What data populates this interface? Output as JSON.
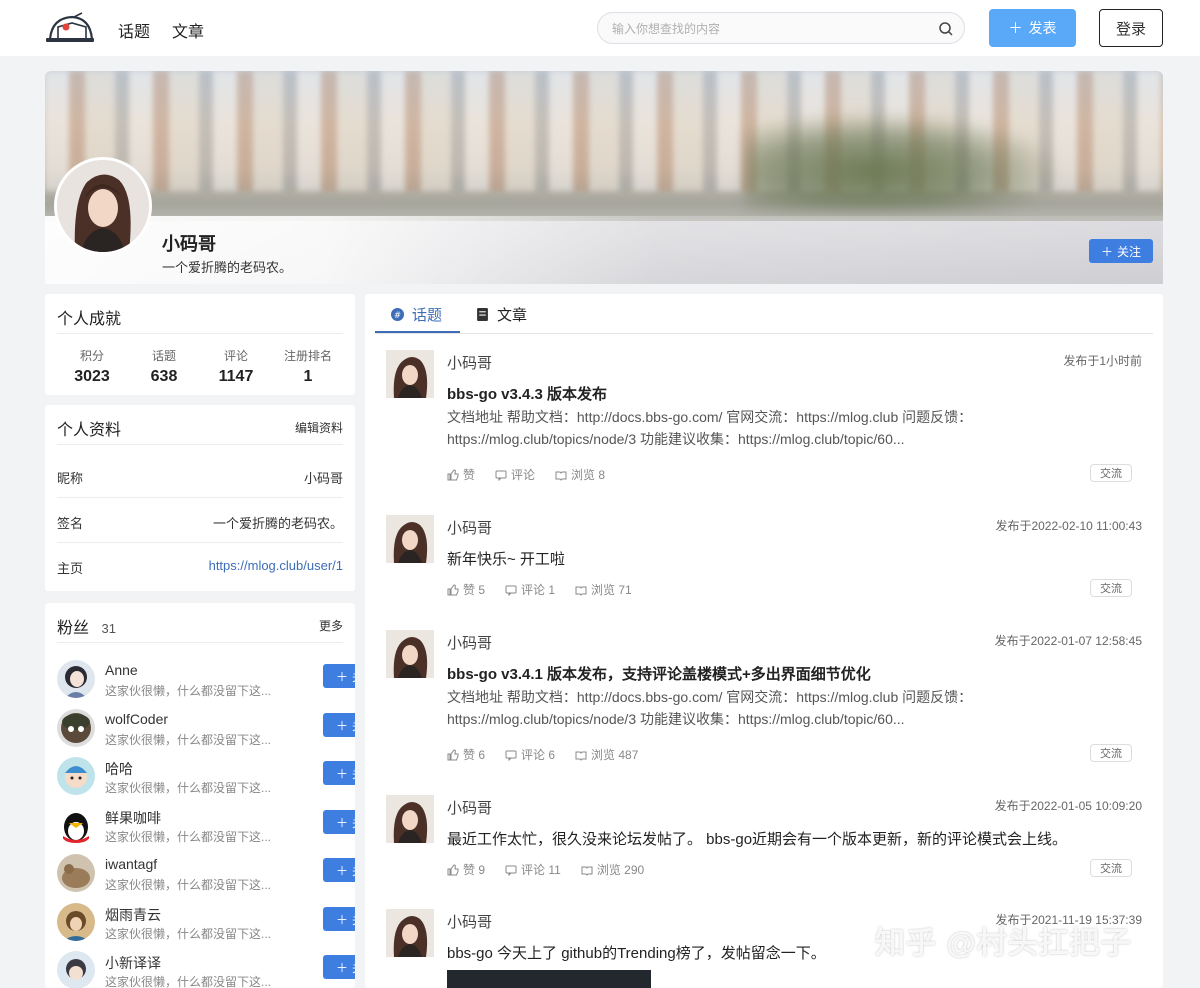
{
  "header": {
    "nav": [
      "话题",
      "文章"
    ],
    "search_placeholder": "输入你想查找的内容",
    "post_label": "发表",
    "login_label": "登录"
  },
  "profile": {
    "name": "小码哥",
    "signature": "一个爱折腾的老码农。",
    "follow_label": "关注"
  },
  "achievements": {
    "title": "个人成就",
    "stats": [
      {
        "label": "积分",
        "value": "3023"
      },
      {
        "label": "话题",
        "value": "638"
      },
      {
        "label": "评论",
        "value": "1147"
      },
      {
        "label": "注册排名",
        "value": "1"
      }
    ]
  },
  "info": {
    "title": "个人资料",
    "edit_label": "编辑资料",
    "rows": [
      {
        "key": "昵称",
        "value": "小码哥"
      },
      {
        "key": "签名",
        "value": "一个爱折腾的老码农。"
      },
      {
        "key": "主页",
        "value": "https://mlog.club/user/1"
      }
    ]
  },
  "fans": {
    "title": "粉丝",
    "count": "31",
    "more_label": "更多",
    "follow_label": "关注",
    "items": [
      {
        "name": "Anne",
        "desc": "这家伙很懒，什么都没留下这..."
      },
      {
        "name": "wolfCoder",
        "desc": "这家伙很懒，什么都没留下这..."
      },
      {
        "name": "哈哈",
        "desc": "这家伙很懒，什么都没留下这..."
      },
      {
        "name": "鲜果咖啡",
        "desc": "这家伙很懒，什么都没留下这..."
      },
      {
        "name": "iwantagf",
        "desc": "这家伙很懒，什么都没留下这..."
      },
      {
        "name": "烟雨青云",
        "desc": "这家伙很懒，什么都没留下这..."
      },
      {
        "name": "小新译译",
        "desc": "这家伙很懒，什么都没留下这..."
      }
    ]
  },
  "tabs": [
    "话题",
    "文章"
  ],
  "posts": [
    {
      "author": "小码哥",
      "time": "发布于1小时前",
      "title": "bbs-go v3.4.3 版本发布",
      "summary": "文档地址 帮助文档：http://docs.bbs-go.com/ 官网交流：https://mlog.club 问题反馈：https://mlog.club/topics/node/3 功能建议收集：https://mlog.club/topic/60...",
      "like": "赞",
      "comment": "评论",
      "view": "浏览 8",
      "tag": "交流"
    },
    {
      "author": "小码哥",
      "time": "发布于2022-02-10 11:00:43",
      "title": "新年快乐~ 开工啦",
      "summary": "",
      "like": "赞 5",
      "comment": "评论 1",
      "view": "浏览 71",
      "tag": "交流"
    },
    {
      "author": "小码哥",
      "time": "发布于2022-01-07 12:58:45",
      "title": "bbs-go v3.4.1 版本发布，支持评论盖楼模式+多出界面细节优化",
      "summary": "文档地址 帮助文档：http://docs.bbs-go.com/ 官网交流：https://mlog.club 问题反馈：https://mlog.club/topics/node/3 功能建议收集：https://mlog.club/topic/60...",
      "like": "赞 6",
      "comment": "评论 6",
      "view": "浏览 487",
      "tag": "交流"
    },
    {
      "author": "小码哥",
      "time": "发布于2022-01-05 10:09:20",
      "title": "最近工作太忙，很久没来论坛发帖了。 bbs-go近期会有一个版本更新，新的评论模式会上线。",
      "summary": "",
      "like": "赞 9",
      "comment": "评论 11",
      "view": "浏览 290",
      "tag": "交流"
    },
    {
      "author": "小码哥",
      "time": "发布于2021-11-19 15:37:39",
      "title": "bbs-go 今天上了 github的Trending榜了，发帖留念一下。",
      "summary": "",
      "like": "",
      "comment": "",
      "view": "",
      "tag": ""
    }
  ],
  "watermark": "知乎 @村头扛把子",
  "colors": {
    "primary": "#3e7ee0",
    "post_button": "#5aa9f8",
    "link": "#3d6db7"
  }
}
